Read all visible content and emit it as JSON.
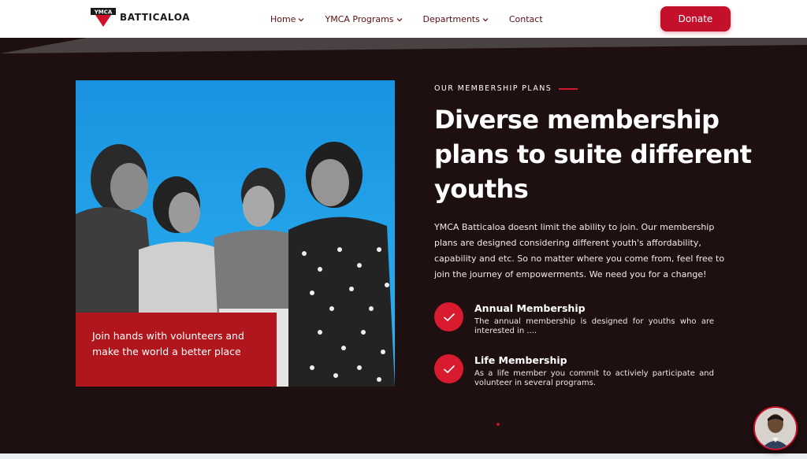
{
  "header": {
    "logo_badge": "YMCA",
    "logo_text": "BATTICALOA",
    "nav": [
      {
        "label": "Home",
        "has_dropdown": true
      },
      {
        "label": "YMCA Programs",
        "has_dropdown": true
      },
      {
        "label": "Departments",
        "has_dropdown": true
      },
      {
        "label": "Contact",
        "has_dropdown": false
      }
    ],
    "donate_label": "Donate"
  },
  "hero": {
    "caption": "Join hands with volunteers and make the world a better place",
    "kicker": "OUR MEMBERSHIP PLANS",
    "title": "Diverse membership plans to suite different youths",
    "description": "YMCA Batticaloa doesnt limit the ability to join. Our membership plans are designed considering different youth's affordability, capability and etc. So no matter where you come from, feel free to join the journey of empowerments. We need you for a change!",
    "plans": [
      {
        "title": "Annual Membership",
        "description": "The annual membership is designed for youths who are interested in ...."
      },
      {
        "title": "Life Membership",
        "description": "As a life member you commit to activiely participate and volunteer in several programs."
      }
    ]
  },
  "colors": {
    "brand_red": "#c4102a",
    "section_bg": "#1e0f10",
    "caption_bg": "#b2161d",
    "photo_sky": "#1d9ee8"
  },
  "icons": [
    "ymca-triangle-logo",
    "chevron-down-icon",
    "check-icon",
    "chat-avatar"
  ]
}
